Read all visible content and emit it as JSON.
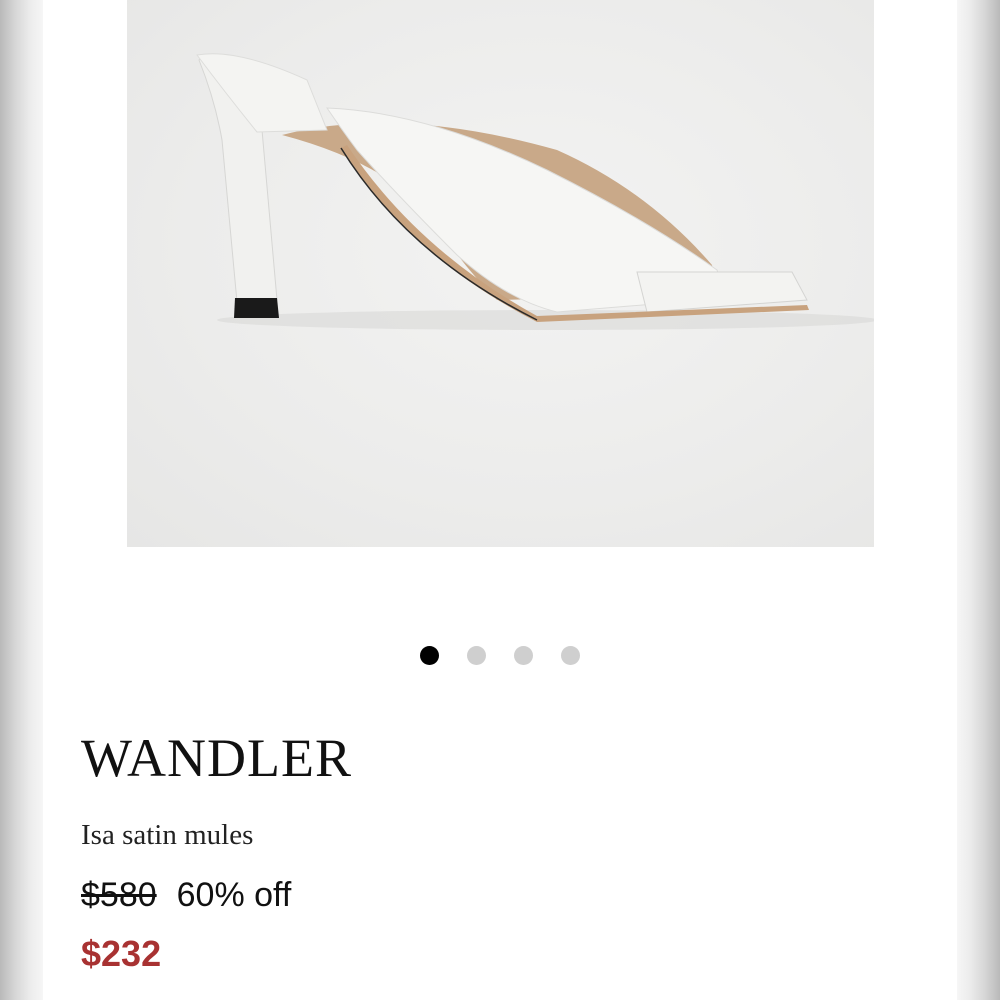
{
  "product": {
    "image_alt": "White satin mule with square toe and block heel",
    "carousel": {
      "total": 4,
      "active_index": 0
    },
    "brand": "WANDLER",
    "name": "Isa satin mules",
    "original_price": "$580",
    "discount": "60% off",
    "sale_price": "$232"
  },
  "colors": {
    "sale_price": "#a83232",
    "dot_active": "#000000",
    "dot_inactive": "#cfcfcf"
  }
}
